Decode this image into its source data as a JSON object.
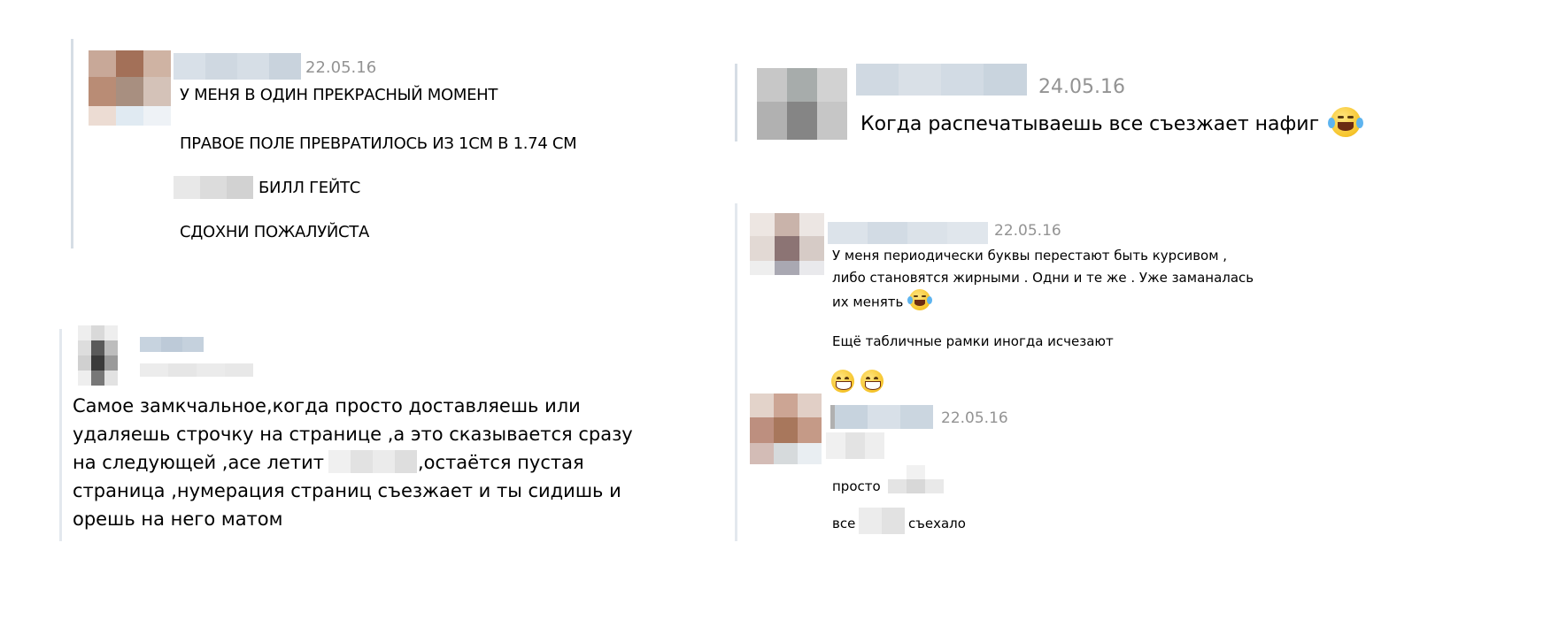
{
  "post1": {
    "date": "22.05.16",
    "lines": [
      "У МЕНЯ В ОДИН ПРЕКРАСНЫЙ МОМЕНТ",
      "ПРАВОЕ ПОЛЕ ПРЕВРАТИЛОСЬ ИЗ 1СМ В 1.74 СМ",
      "БИЛЛ ГЕЙТС",
      "СДОХНИ ПОЖАЛУЙСТА"
    ]
  },
  "post2": {
    "text_lines": [
      "Самое замкчальное,когда просто доставляешь или",
      "удаляешь строчку на странице ,а это сказывается сразу",
      "на следующей ,асе летит",
      ",остаётся пустая",
      "страница ,нумерация страниц съезжает и ты сидишь и",
      "орешь на него матом"
    ]
  },
  "post3": {
    "date": "24.05.16",
    "text": "Когда распечатываешь все съезжает нафиг"
  },
  "post4": {
    "date": "22.05.16",
    "lines": [
      "У меня периодически буквы перестают быть курсивом ,",
      "либо становятся жирными . Одни и те же . Уже заманалась",
      "их менять",
      "Ещё табличные рамки иногда исчезают"
    ]
  },
  "post5": {
    "date": "22.05.16",
    "line1": "просто",
    "line2_start": "все",
    "line2_end": "съехало"
  },
  "icons": {
    "laugh": "face-with-tears-of-joy-icon",
    "grin": "grinning-face-icon"
  },
  "colors": {
    "quote_bar": "#d6dde5",
    "date": "#939393",
    "blur": "#d5dde6"
  }
}
